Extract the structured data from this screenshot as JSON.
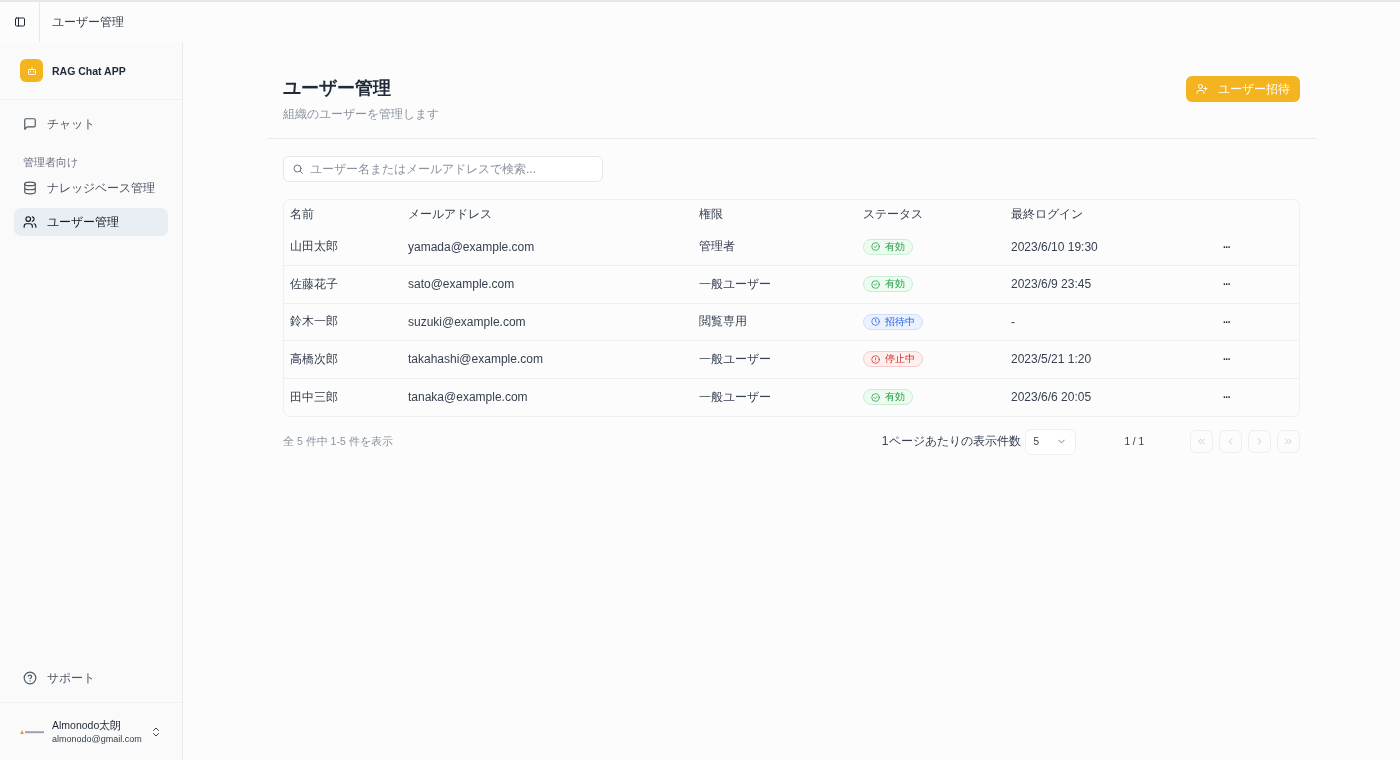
{
  "topbar": {
    "breadcrumb": "ユーザー管理"
  },
  "sidebar": {
    "app_name": "RAG Chat APP",
    "items": [
      {
        "label": "チャット",
        "selected": false
      }
    ],
    "section_title": "管理者向け",
    "admin_items": [
      {
        "label": "ナレッジベース管理",
        "selected": false
      },
      {
        "label": "ユーザー管理",
        "selected": true
      }
    ],
    "support": "サポート",
    "user": {
      "name": "Almonodo太朗",
      "email": "almonodo@gmail.com"
    }
  },
  "header": {
    "title": "ユーザー管理",
    "subtitle": "組織のユーザーを管理します",
    "invite_button": "ユーザー招待"
  },
  "search": {
    "placeholder": "ユーザー名またはメールアドレスで検索..."
  },
  "table": {
    "columns": [
      "名前",
      "メールアドレス",
      "権限",
      "ステータス",
      "最終ログイン"
    ],
    "rows": [
      {
        "name": "山田太郎",
        "email": "yamada@example.com",
        "role": "管理者",
        "status": {
          "kind": "active",
          "label": "有効"
        },
        "last_login": "2023/6/10 19:30",
        "menu": "···"
      },
      {
        "name": "佐藤花子",
        "email": "sato@example.com",
        "role": "一般ユーザー",
        "status": {
          "kind": "active",
          "label": "有効"
        },
        "last_login": "2023/6/9 23:45",
        "menu": "···"
      },
      {
        "name": "鈴木一郎",
        "email": "suzuki@example.com",
        "role": "閲覧専用",
        "status": {
          "kind": "invited",
          "label": "招待中"
        },
        "last_login": "-",
        "menu": "···"
      },
      {
        "name": "高橋次郎",
        "email": "takahashi@example.com",
        "role": "一般ユーザー",
        "status": {
          "kind": "suspended",
          "label": "停止中"
        },
        "last_login": "2023/5/21 1:20",
        "menu": "···"
      },
      {
        "name": "田中三郎",
        "email": "tanaka@example.com",
        "role": "一般ユーザー",
        "status": {
          "kind": "active",
          "label": "有効"
        },
        "last_login": "2023/6/6 20:05",
        "menu": "···"
      }
    ]
  },
  "pagination": {
    "summary": "全 5 件中 1-5 件を表示",
    "per_page_label": "1ページあたりの表示件数",
    "per_page": "5",
    "page": "1 / 1",
    "buttons": [
      {
        "kind": "first",
        "disabled": true
      },
      {
        "kind": "prev",
        "disabled": true
      },
      {
        "kind": "next",
        "disabled": true
      },
      {
        "kind": "last",
        "disabled": true
      }
    ]
  }
}
